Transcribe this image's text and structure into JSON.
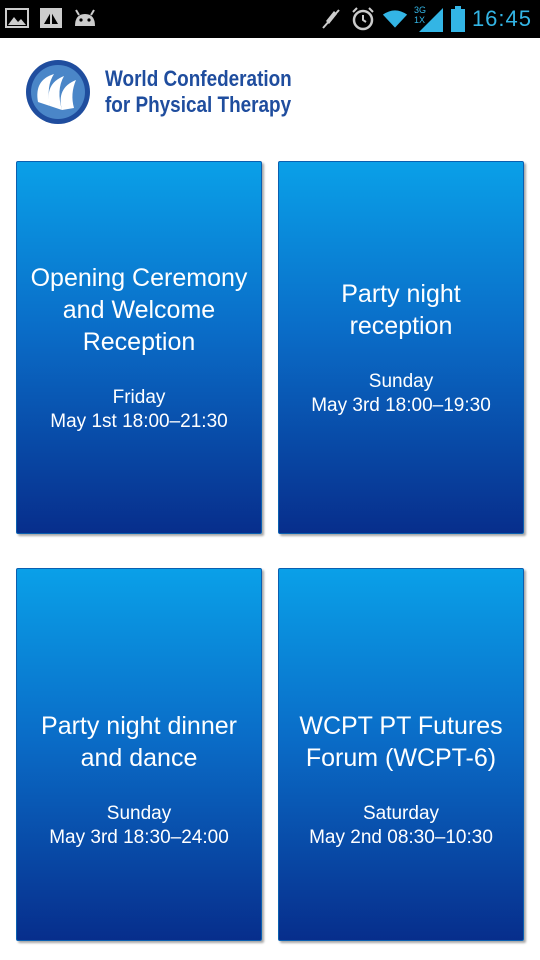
{
  "status_bar": {
    "time": "16:45",
    "network_label_top": "3G",
    "network_label_bottom": "1X",
    "left_icons": [
      "gallery-icon",
      "app-icon",
      "android-icon"
    ],
    "right_icons": [
      "mute-icon",
      "alarm-icon",
      "wifi-icon",
      "signal-icon",
      "battery-icon"
    ],
    "time_color": "#33b5e5"
  },
  "header": {
    "org_line1": "World Confederation",
    "org_line2": "for Physical Therapy",
    "brand_color": "#1f4d9e"
  },
  "events": [
    {
      "title_line1": "Opening Ceremony",
      "title_line2": "and Welcome",
      "title_line3": "Reception",
      "day": "Friday",
      "date": "May 1st 18:00–21:30"
    },
    {
      "title_line1": "Party night",
      "title_line2": "reception",
      "title_line3": "",
      "day": "Sunday",
      "date": "May 3rd 18:00–19:30"
    },
    {
      "title_line1": "Party night dinner",
      "title_line2": "and dance",
      "title_line3": "",
      "day": "Sunday",
      "date": "May 3rd 18:30–24:00"
    },
    {
      "title_line1": "WCPT PT Futures",
      "title_line2": "Forum (WCPT-6)",
      "title_line3": "",
      "day": "Saturday",
      "date": "May 2nd 08:30–10:30"
    }
  ],
  "colors": {
    "tile_top": "#0aa0e8",
    "tile_bottom": "#072e8c"
  }
}
